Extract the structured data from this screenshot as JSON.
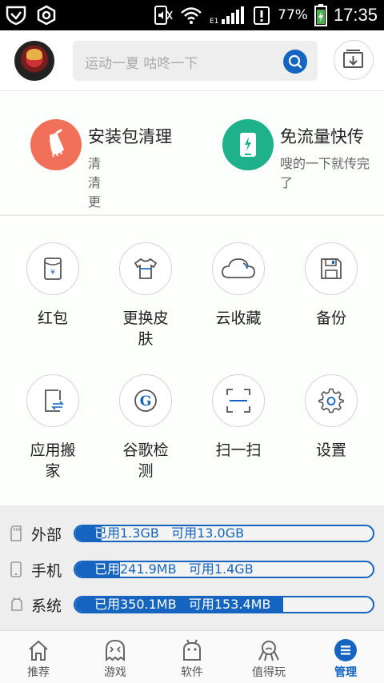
{
  "status_bar": {
    "battery_pct": "77%",
    "time": "17:35",
    "network": "E1"
  },
  "header": {
    "search_placeholder": "运动一夏 咕咚一下"
  },
  "features": [
    {
      "title": "安装包清理",
      "subtitle": "清清更健康",
      "color": "#f0705a"
    },
    {
      "title": "免流量快传",
      "subtitle": "嗖的一下就传完了",
      "color": "#1fb08c"
    }
  ],
  "tools": [
    {
      "label": "红包"
    },
    {
      "label": "更换皮肤"
    },
    {
      "label": "云收藏"
    },
    {
      "label": "备份"
    },
    {
      "label": "应用搬家"
    },
    {
      "label": "谷歌检测"
    },
    {
      "label": "扫一扫"
    },
    {
      "label": "设置"
    }
  ],
  "storage": [
    {
      "name": "外部",
      "usage": "已用1.3GB   可用13.0GB",
      "used_fraction": 0.09
    },
    {
      "name": "手机",
      "usage": "已用241.9MB   可用1.4GB",
      "used_fraction": 0.15
    },
    {
      "name": "系统",
      "usage": "已用350.1MB   可用153.4MB",
      "used_fraction": 0.7
    }
  ],
  "nav": [
    {
      "label": "推荐"
    },
    {
      "label": "游戏"
    },
    {
      "label": "软件"
    },
    {
      "label": "值得玩"
    },
    {
      "label": "管理"
    }
  ],
  "colors": {
    "accent": "#1565c0",
    "clean": "#f0705a",
    "transfer": "#1fb08c"
  }
}
